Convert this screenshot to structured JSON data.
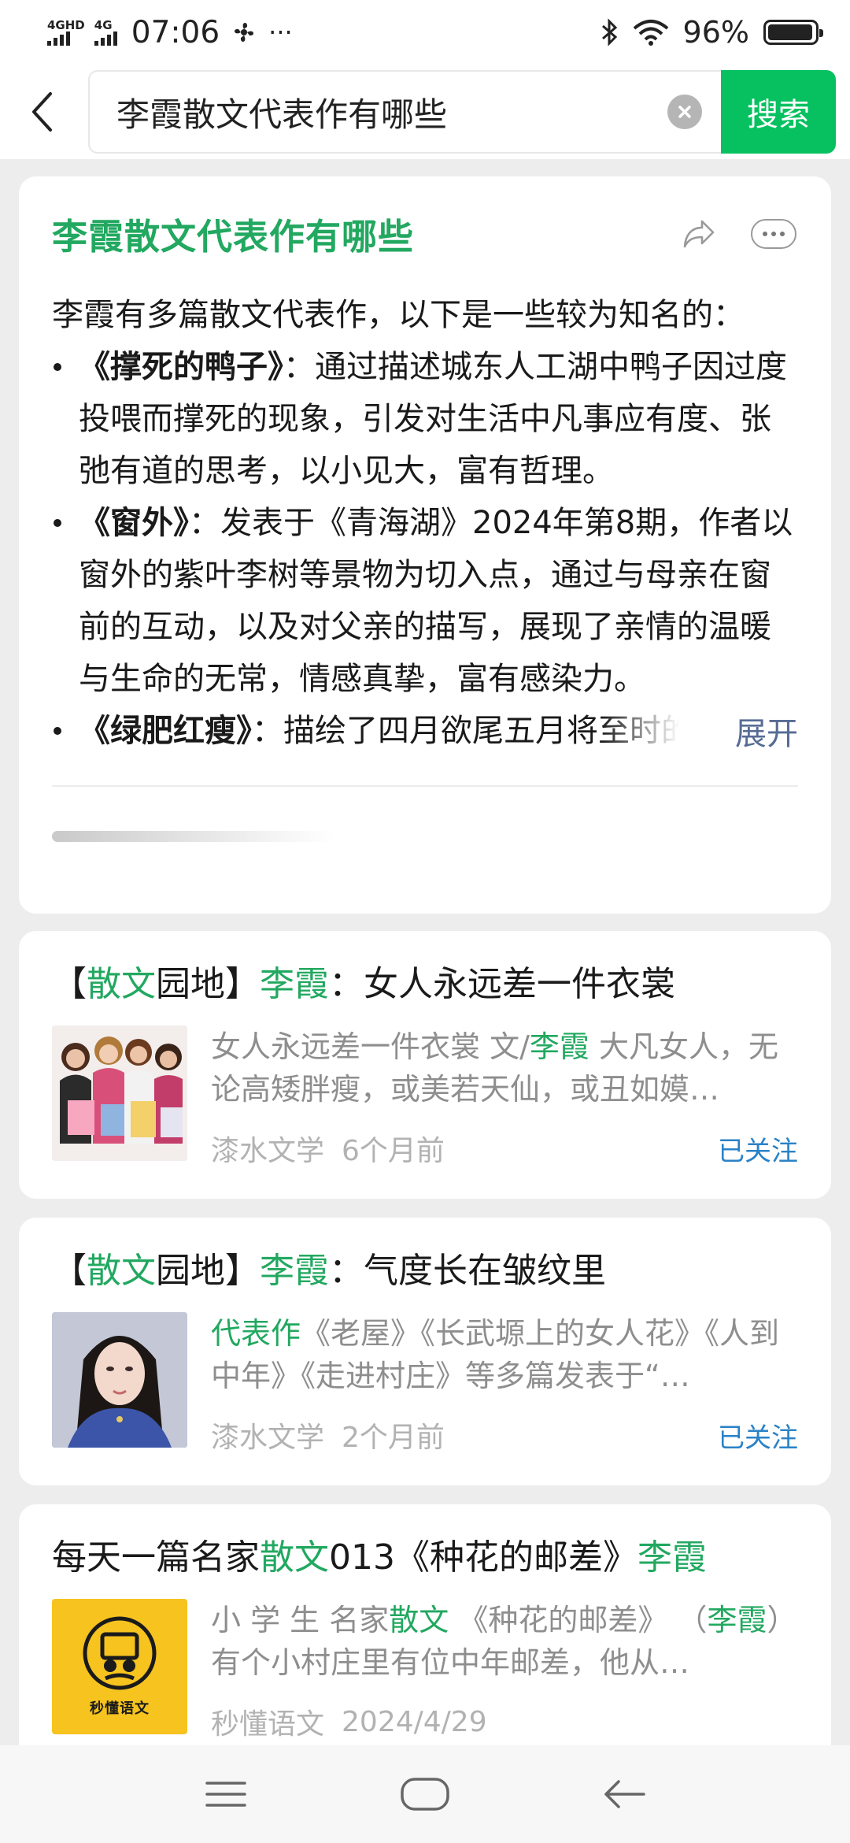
{
  "status_bar": {
    "network_1": "4GHD",
    "network_2": "4G",
    "time": "07:06",
    "more": "···",
    "battery": "96%",
    "battery_level": 0.96
  },
  "search": {
    "query": "李霞散文代表作有哪些",
    "button_label": "搜索",
    "accent_color": "#07c160"
  },
  "ai_answer": {
    "title": "李霞散文代表作有哪些",
    "intro": "李霞有多篇散文代表作，以下是一些较为知名的：",
    "items": [
      {
        "name": "《撑死的鸭子》",
        "text": "：通过描述城东人工湖中鸭子因过度投喂而撑死的现象，引发对生活中凡事应有度、张弛有道的思考，以小见大，富有哲理。"
      },
      {
        "name": "《窗外》",
        "text": "：发表于《青海湖》2024年第8期，作者以窗外的紫叶李树等景物为切入点，通过与母亲在窗前的互动，以及对父亲的描写，展现了亲情的温暖与生命的无常，情感真挚，富有感染力。"
      },
      {
        "name": "《绿肥红瘦》",
        "text": "：描绘了四月欲尾五月将至时的季节景象，杏花、梨花、桃花、樱花等相继绽放又飘落"
      }
    ],
    "expand_label": "展开",
    "icons": [
      "share-icon",
      "more-icon"
    ]
  },
  "results": [
    {
      "title_parts": [
        {
          "t": "【",
          "hl": false
        },
        {
          "t": "散文",
          "hl": true
        },
        {
          "t": "园地】",
          "hl": false
        },
        {
          "t": "李霞",
          "hl": true
        },
        {
          "t": "：女人永远差一件衣裳",
          "hl": false
        }
      ],
      "snippet_parts": [
        {
          "t": "女人永远差一件衣裳 文/",
          "hl": false
        },
        {
          "t": "李霞",
          "hl": true
        },
        {
          "t": " 大凡女人，无论高矮胖瘦，或美若天仙，或丑如嫫…",
          "hl": false
        }
      ],
      "source": "漆水文学",
      "date": "6个月前",
      "follow_label": "已关注"
    },
    {
      "title_parts": [
        {
          "t": "【",
          "hl": false
        },
        {
          "t": "散文",
          "hl": true
        },
        {
          "t": "园地】",
          "hl": false
        },
        {
          "t": "李霞",
          "hl": true
        },
        {
          "t": "：气度长在皱纹里",
          "hl": false
        }
      ],
      "snippet_parts": [
        {
          "t": "代表作",
          "hl": true
        },
        {
          "t": "《老屋》《长武塬上的女人花》《人到中年》《走进村庄》等多篇发表于“…",
          "hl": false
        }
      ],
      "source": "漆水文学",
      "date": "2个月前",
      "follow_label": "已关注"
    },
    {
      "title_parts": [
        {
          "t": "每天一篇名家",
          "hl": false
        },
        {
          "t": "散文",
          "hl": true
        },
        {
          "t": "013《种花的邮差》",
          "hl": false
        },
        {
          "t": "李霞",
          "hl": true
        }
      ],
      "snippet_parts": [
        {
          "t": "小 学 生 名家",
          "hl": false
        },
        {
          "t": "散文",
          "hl": true
        },
        {
          "t": " 《种花的邮差》 （",
          "hl": false
        },
        {
          "t": "李霞",
          "hl": true
        },
        {
          "t": "）有个小村庄里有位中年邮差，他从…",
          "hl": false
        }
      ],
      "source": "秒懂语文",
      "date": "2024/4/29",
      "logo_text": "秒懂语文"
    }
  ],
  "nav": {
    "icons": [
      "menu-icon",
      "home-icon",
      "back-icon"
    ]
  }
}
